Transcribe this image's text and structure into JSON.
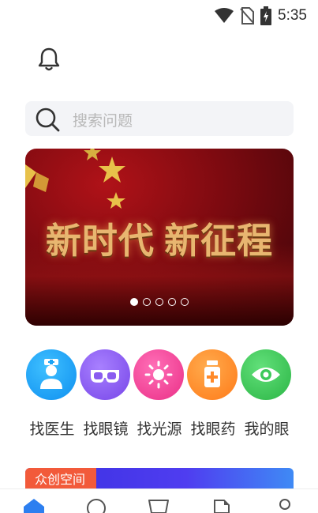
{
  "status_bar": {
    "time": "5:35",
    "icons": [
      "wifi-icon",
      "no-sim-icon",
      "battery-charging-icon"
    ]
  },
  "header": {
    "bell_icon": "bell-icon"
  },
  "search": {
    "placeholder": "搜索问题",
    "icon": "search-icon"
  },
  "banner": {
    "title": "新时代 新征程",
    "slides_total": 5,
    "active_slide": 1
  },
  "categories": [
    {
      "label": "找医生",
      "icon": "doctor-icon",
      "color": "#1aa3f5"
    },
    {
      "label": "找眼镜",
      "icon": "glasses-icon",
      "color": "#8a5cf0"
    },
    {
      "label": "找光源",
      "icon": "sun-icon",
      "color": "#f0479b"
    },
    {
      "label": "找眼药",
      "icon": "medicine-bottle-icon",
      "color": "#ff8a2a"
    },
    {
      "label": "我的眼",
      "icon": "eye-icon",
      "color": "#3ec95a"
    }
  ],
  "promo": {
    "tag": "众创空间"
  },
  "tabbar": {
    "icons": [
      "home-icon",
      "chat-icon",
      "cart-icon",
      "note-icon",
      "profile-icon"
    ],
    "active_color": "#2d7ff0"
  }
}
